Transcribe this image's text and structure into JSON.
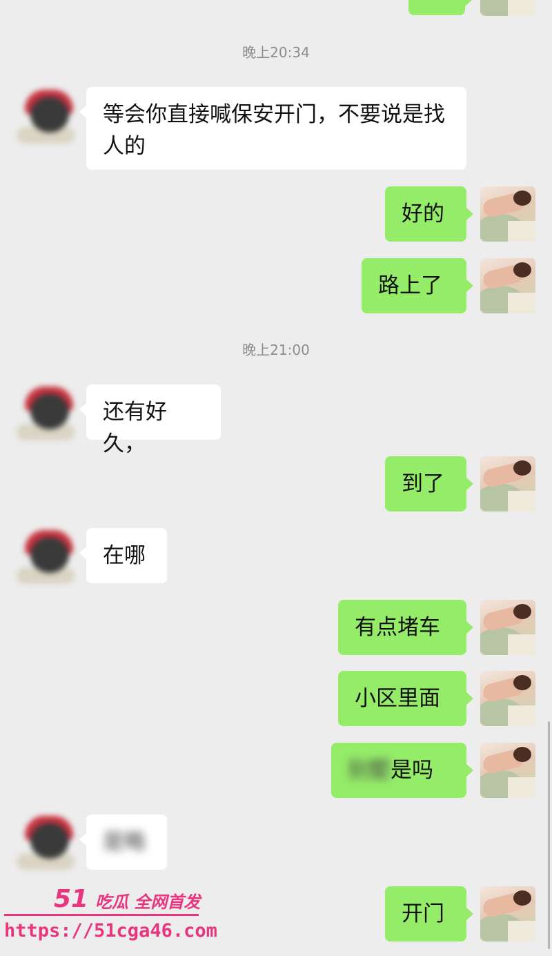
{
  "timestamps": [
    "晚上20:34",
    "晚上21:00"
  ],
  "messages": [
    {
      "side": "out",
      "text": ""
    },
    {
      "side": "in",
      "text": "等会你直接喊保安开门，不要说是找人的"
    },
    {
      "side": "out",
      "text": "好的"
    },
    {
      "side": "out",
      "text": "路上了"
    },
    {
      "side": "in",
      "text": "还有好久，"
    },
    {
      "side": "out",
      "text": "到了"
    },
    {
      "side": "in",
      "text": "在哪"
    },
    {
      "side": "out",
      "text": "有点堵车"
    },
    {
      "side": "out",
      "text": "小区里面"
    },
    {
      "side": "out",
      "text": "是吗",
      "blurred_prefix": "别墅"
    },
    {
      "side": "in",
      "text": "",
      "blurred_text": "是略"
    },
    {
      "side": "out",
      "text": "开门"
    }
  ],
  "watermark": {
    "logo": "51",
    "tagline": "吃瓜 全网首发",
    "url": "https://51cga46.com"
  },
  "colors": {
    "background": "#ededed",
    "incoming_bubble": "#ffffff",
    "outgoing_bubble": "#95ec69",
    "timestamp": "#8c8c8c",
    "watermark": "#e8357e"
  }
}
